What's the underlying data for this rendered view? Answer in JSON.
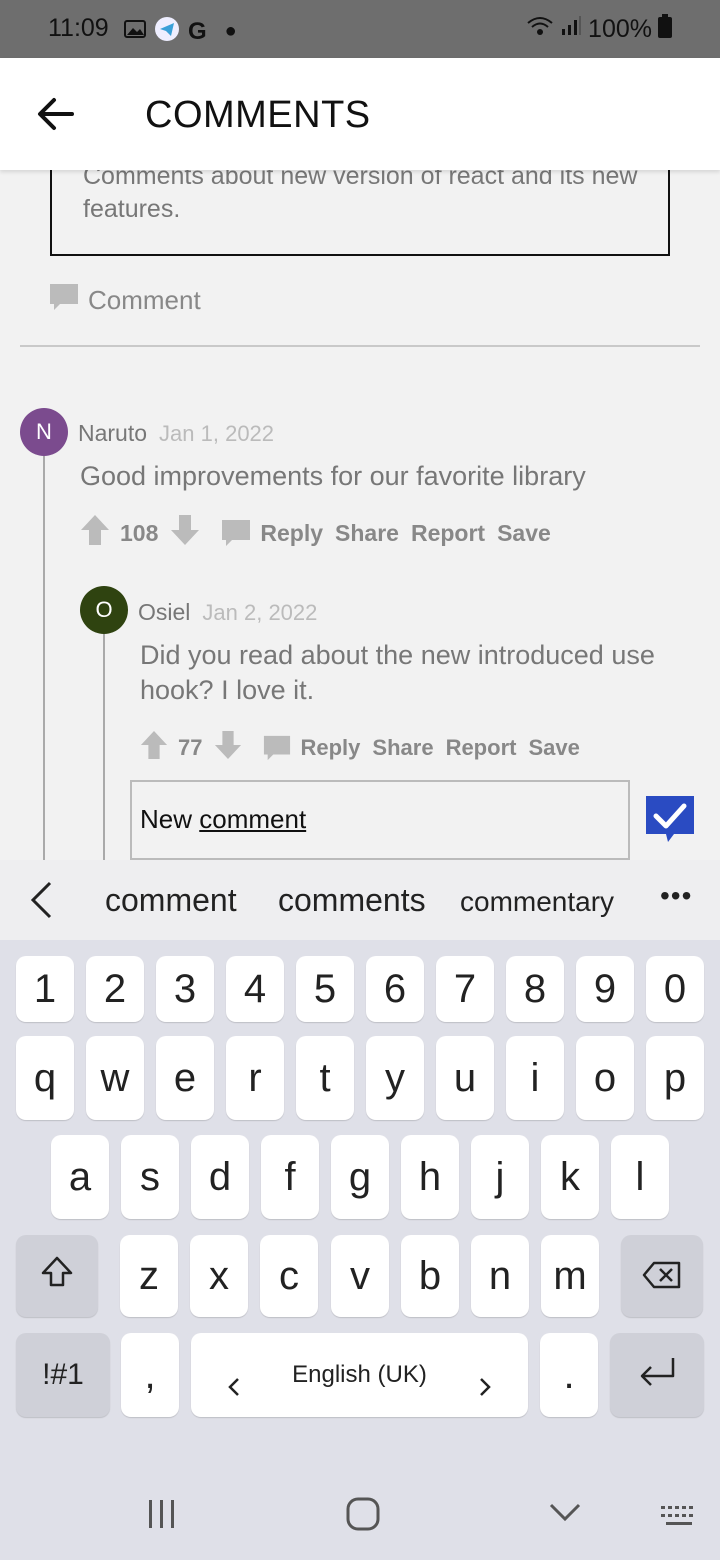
{
  "status_bar": {
    "time": "11:09",
    "battery": "100%"
  },
  "app_bar": {
    "title": "COMMENTS"
  },
  "post": {
    "description": "Comments about new version of react and its new features.",
    "comment_link": "Comment"
  },
  "comments": [
    {
      "avatar_letter": "N",
      "avatar_color": "#7b4b8e",
      "author": "Naruto",
      "date": "Jan 1, 2022",
      "text": "Good improvements for our favorite library",
      "votes": "108",
      "reply": "Reply",
      "share": "Share",
      "report": "Report",
      "save": "Save"
    },
    {
      "avatar_letter": "O",
      "avatar_color": "#2f4310",
      "author": "Osiel",
      "date": "Jan 2, 2022",
      "text": "Did you read about the new introduced use hook? I love it.",
      "votes": "77",
      "reply": "Reply",
      "share": "Share",
      "report": "Report",
      "save": "Save"
    }
  ],
  "new_comment": {
    "word1": "New",
    "word2": "comment"
  },
  "suggestions": [
    "comment",
    "comments",
    "commentary"
  ],
  "keyboard": {
    "row_numbers": [
      "1",
      "2",
      "3",
      "4",
      "5",
      "6",
      "7",
      "8",
      "9",
      "0"
    ],
    "row1": [
      "q",
      "w",
      "e",
      "r",
      "t",
      "y",
      "u",
      "i",
      "o",
      "p"
    ],
    "row2": [
      "a",
      "s",
      "d",
      "f",
      "g",
      "h",
      "j",
      "k",
      "l"
    ],
    "row3": [
      "z",
      "x",
      "c",
      "v",
      "b",
      "n",
      "m"
    ],
    "symbols": "!#1",
    "comma": ",",
    "language": "English (UK)",
    "period": "."
  },
  "colors": {
    "accent": "#2a4bc2",
    "app_bar": "#ffffff",
    "status_bar": "#6e6e6e"
  }
}
